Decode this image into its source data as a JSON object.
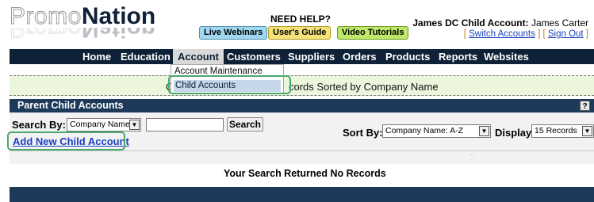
{
  "brand": {
    "logo_promo": "Promo",
    "logo_nation": "Nation"
  },
  "help": {
    "title": "NEED HELP?",
    "buttons": [
      "Live Webinars",
      "User's Guide",
      "Video Tutorials"
    ]
  },
  "user": {
    "account_label": "James DC Child Account:",
    "name": "James Carter",
    "links": {
      "open": "[ ",
      "switch": "Switch Accounts",
      "mid": " ] [ ",
      "signout": "Sign Out",
      "close": " ]"
    }
  },
  "nav": {
    "items": [
      "Home",
      "Education",
      "Account",
      "Customers",
      "Suppliers",
      "Orders",
      "Products",
      "Reports",
      "Websites"
    ],
    "active": "Account",
    "dropdown": [
      "Account Maintenance",
      "Child Accounts"
    ]
  },
  "banner": {
    "prefix": "C",
    "text": "cords Sorted by Company Name"
  },
  "panel": {
    "title": "Parent Child Accounts",
    "help_icon": "?",
    "search_label": "Search By:",
    "search_by_value": "Company Name",
    "search_input_value": "",
    "search_button": "Search",
    "add_link": "Add New Child Account",
    "sort_label": "Sort By:",
    "sort_value": "Company Name: A-Z",
    "display_label": "Display:",
    "display_value": "15 Records",
    "dots": "..",
    "empty_message": "Your Search Returned No Records"
  },
  "colors": {
    "nav_bg": "#0f2136",
    "panel_header_bg": "#1e3a5a",
    "banner_bg": "#ebf6dd",
    "highlight": "#4aa96c",
    "link": "#1a3fbf"
  },
  "icons": {
    "select_arrow": "chevron-down-icon",
    "help": "help-icon"
  }
}
